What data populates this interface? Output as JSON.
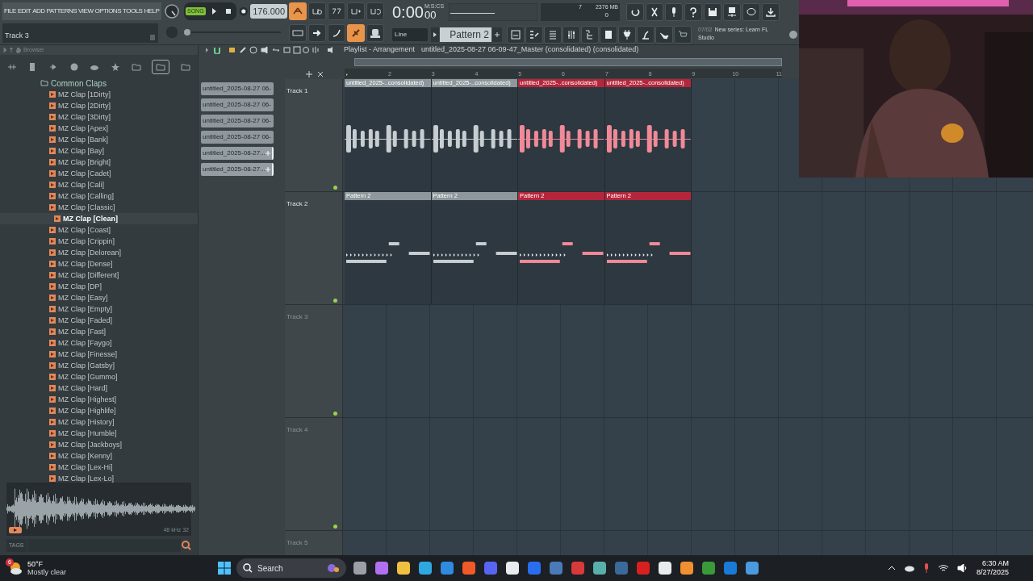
{
  "menu": [
    {
      "label": "FILE"
    },
    {
      "label": "EDIT"
    },
    {
      "label": "ADD"
    },
    {
      "label": "PATTERNS"
    },
    {
      "label": "VIEW"
    },
    {
      "label": "OPTIONS"
    },
    {
      "label": "TOOLS"
    },
    {
      "label": "HELP"
    }
  ],
  "hint_bar": {
    "text": "Track 3"
  },
  "transport": {
    "mode_label": "SONG",
    "song_mode": true,
    "tempo": "176.000",
    "time": "0:00",
    "time_cs": "00",
    "time_format": "M:S:CS"
  },
  "toggles_top": [
    {
      "on": true
    },
    {
      "on": false
    },
    {
      "on": false
    },
    {
      "on": false
    },
    {
      "on": false
    }
  ],
  "toggles_bottom": [
    {
      "on": false
    },
    {
      "on": false
    },
    {
      "on": false
    },
    {
      "on": true
    },
    {
      "on": false
    }
  ],
  "master_slider": {
    "level": 0
  },
  "monitor": {
    "polyphony": "7",
    "memory": "2376 MB",
    "voices": "0"
  },
  "snap": "Line",
  "pattern": "Pattern 2",
  "news": {
    "date": "07/02",
    "text": "New series: Learn FL Studio"
  },
  "browser": {
    "title": "Browser",
    "folder": "Common Claps",
    "items": [
      {
        "label": "MZ Clap [1Dirty]",
        "selected": false
      },
      {
        "label": "MZ Clap [2Dirty]",
        "selected": false
      },
      {
        "label": "MZ Clap [3Dirty]",
        "selected": false
      },
      {
        "label": "MZ Clap [Apex]",
        "selected": false
      },
      {
        "label": "MZ Clap [Bank]",
        "selected": false
      },
      {
        "label": "MZ Clap [Bay]",
        "selected": false
      },
      {
        "label": "MZ Clap [Bright]",
        "selected": false
      },
      {
        "label": "MZ Clap [Cadet]",
        "selected": false
      },
      {
        "label": "MZ Clap [Cali]",
        "selected": false
      },
      {
        "label": "MZ Clap [Calling]",
        "selected": false
      },
      {
        "label": "MZ Clap [Classic]",
        "selected": false
      },
      {
        "label": "MZ Clap [Clean]",
        "selected": true
      },
      {
        "label": "MZ Clap [Coast]",
        "selected": false
      },
      {
        "label": "MZ Clap [Crippin]",
        "selected": false
      },
      {
        "label": "MZ Clap [Delorean]",
        "selected": false
      },
      {
        "label": "MZ Clap [Dense]",
        "selected": false
      },
      {
        "label": "MZ Clap [Different]",
        "selected": false
      },
      {
        "label": "MZ Clap [DP]",
        "selected": false
      },
      {
        "label": "MZ Clap [Easy]",
        "selected": false
      },
      {
        "label": "MZ Clap [Empty]",
        "selected": false
      },
      {
        "label": "MZ Clap [Faded]",
        "selected": false
      },
      {
        "label": "MZ Clap [Fast]",
        "selected": false
      },
      {
        "label": "MZ Clap [Faygo]",
        "selected": false
      },
      {
        "label": "MZ Clap [Finesse]",
        "selected": false
      },
      {
        "label": "MZ Clap [Gatsby]",
        "selected": false
      },
      {
        "label": "MZ Clap [Gummo]",
        "selected": false
      },
      {
        "label": "MZ Clap [Hard]",
        "selected": false
      },
      {
        "label": "MZ Clap [Highest]",
        "selected": false
      },
      {
        "label": "MZ Clap [Highlife]",
        "selected": false
      },
      {
        "label": "MZ Clap [History]",
        "selected": false
      },
      {
        "label": "MZ Clap [Humble]",
        "selected": false
      },
      {
        "label": "MZ Clap [Jackboys]",
        "selected": false
      },
      {
        "label": "MZ Clap [Kenny]",
        "selected": false
      },
      {
        "label": "MZ Clap [Lex-Hi]",
        "selected": false
      },
      {
        "label": "MZ Clap [Lex-Lo]",
        "selected": false
      }
    ],
    "sample_info": "48 kHz 32",
    "tags_label": "TAGS"
  },
  "playlist": {
    "title": "Playlist - Arrangement",
    "path": "untitled_2025-08-27 06-09-47_Master (consolidated) (consolidated)",
    "ruler": [
      "2",
      "3",
      "4",
      "5",
      "6",
      "7",
      "8",
      "9",
      "10",
      "11"
    ],
    "picker": [
      {
        "label": "untitled_2025-08-27 06-",
        "icon": false
      },
      {
        "label": "untitled_2025-08-27 06-",
        "icon": false
      },
      {
        "label": "untitled_2025-08-27 06-",
        "icon": false
      },
      {
        "label": "untitled_2025-08-27 06-",
        "icon": false
      },
      {
        "label": "untitled_2025-08-27...",
        "icon": true
      },
      {
        "label": "untitled_2025-08-27...",
        "icon": true
      }
    ],
    "tracks": [
      {
        "name": "Track 1",
        "clips": [
          {
            "kind": "audio",
            "label": "untitled_2025-..consolidated)",
            "color": "#8d979c"
          },
          {
            "kind": "audio",
            "label": "untitled_2025-..consolidated)",
            "color": "#8d979c"
          },
          {
            "kind": "audio",
            "label": "untitled_2025-..consolidated)",
            "color": "#b4263b"
          },
          {
            "kind": "audio",
            "label": "untitled_2025-..consolidated)",
            "color": "#b4263b"
          }
        ]
      },
      {
        "name": "Track 2",
        "clips": [
          {
            "kind": "pattern",
            "label": "Pattern 2",
            "color": "#8d979c"
          },
          {
            "kind": "pattern",
            "label": "Pattern 2",
            "color": "#8d979c"
          },
          {
            "kind": "pattern",
            "label": "Pattern 2",
            "color": "#b4263b"
          },
          {
            "kind": "pattern",
            "label": "Pattern 2",
            "color": "#b4263b"
          }
        ]
      },
      {
        "name": "Track 3"
      },
      {
        "name": "Track 4"
      },
      {
        "name": "Track 5"
      }
    ]
  },
  "taskbar": {
    "weather_temp": "50°F",
    "weather_text": "Mostly clear",
    "weather_badge": "6",
    "search": "Search",
    "time": "6:30 AM",
    "date": "8/27/2025"
  }
}
